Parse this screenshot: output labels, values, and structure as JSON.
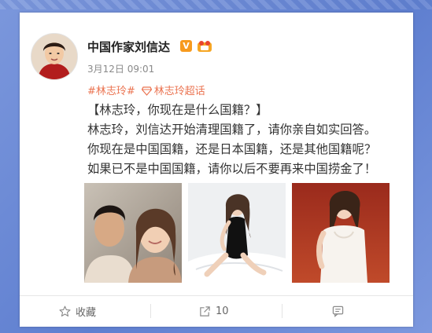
{
  "post": {
    "author": "中国作家刘信达",
    "time": "3月12日 09:01",
    "topic_tag": "#林志玲#",
    "super_topic": "林志玲超话",
    "lines": [
      "【林志玲，你现在是什么国籍？】",
      "林志玲，刘信达开始清理国籍了，请你亲自如实回答。",
      "你现在是中国国籍，还是日本国籍，还是其他国籍呢？",
      "如果已不是中国国籍，请你以后不要再来中国捞金了！"
    ],
    "images": [
      "photo-couple",
      "photo-white-dress-bed",
      "photo-red-carpet-white-dress"
    ]
  },
  "actions": {
    "favorite_label": "收藏",
    "share_count": "10",
    "comment_label": ""
  },
  "colors": {
    "background": "#6f8fd9",
    "card": "#ffffff",
    "link_orange": "#eb7350",
    "verified_badge": "#f79a1e"
  },
  "icons": {
    "verified": "verified-v-icon",
    "level": "level-badge-icon",
    "super_topic": "diamond-icon",
    "favorite": "star-icon",
    "share": "share-arrow-icon",
    "comment": "comment-icon"
  }
}
